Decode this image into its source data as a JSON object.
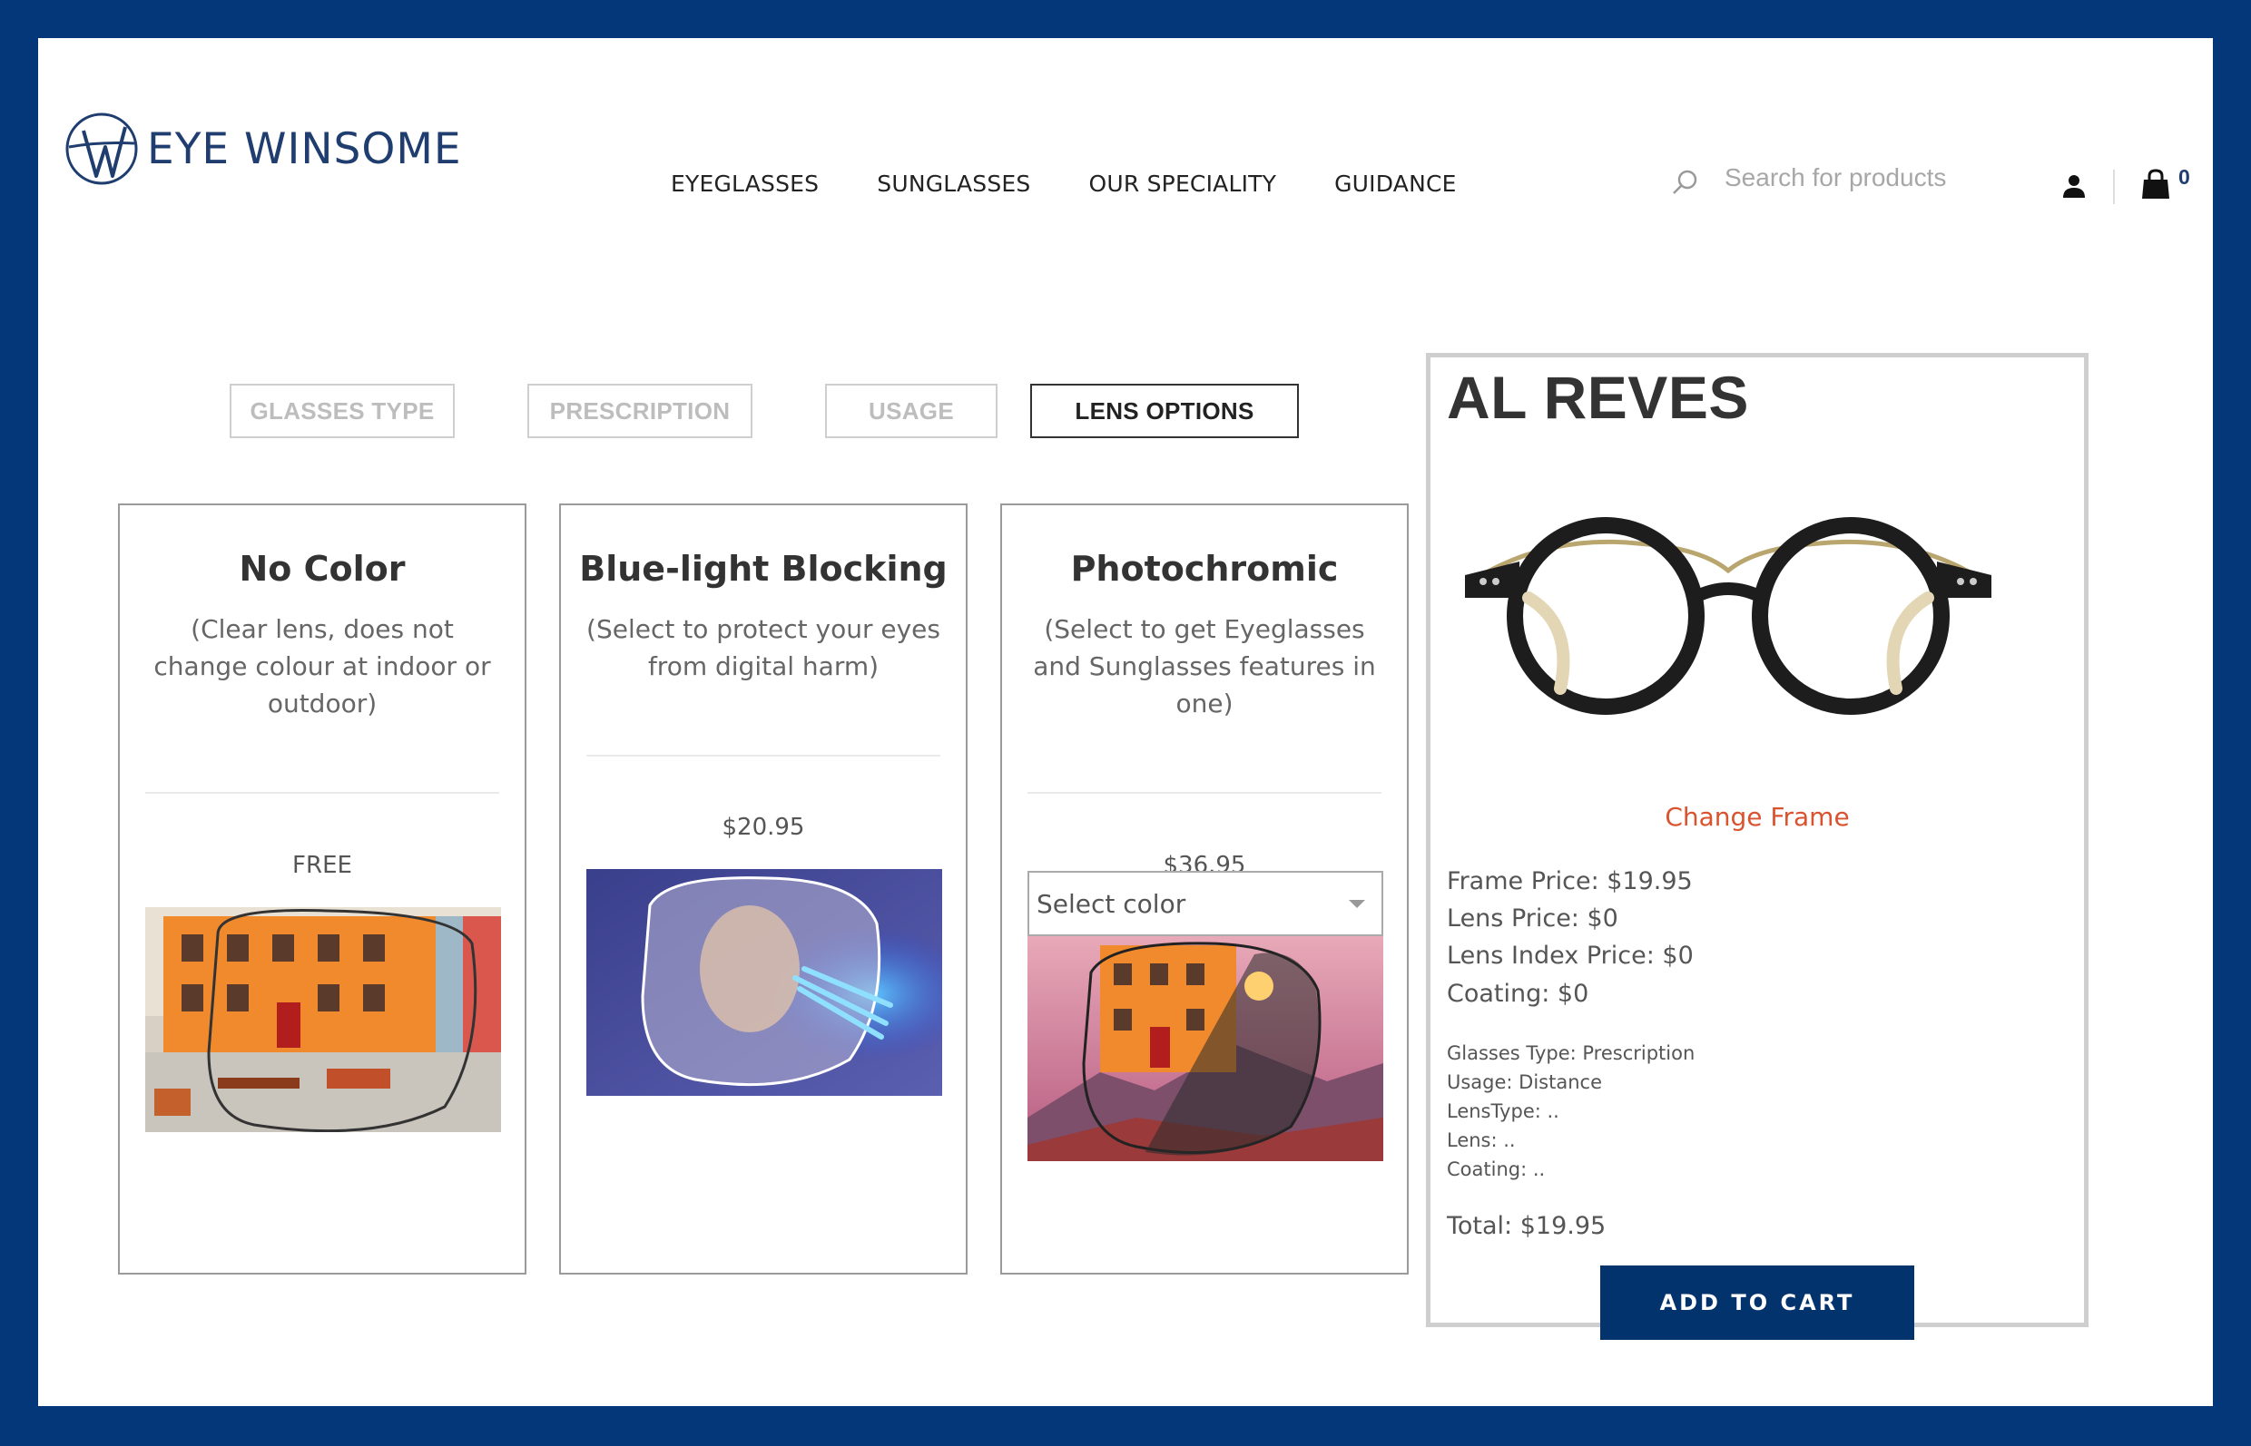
{
  "brand": {
    "name": "EYE WINSOME",
    "primary_color": "#03377a",
    "accent_color": "#d9532f"
  },
  "nav": {
    "items": [
      "EYEGLASSES",
      "SUNGLASSES",
      "OUR SPECIALITY",
      "GUIDANCE"
    ]
  },
  "search": {
    "placeholder": "Search for products",
    "icon": "search-icon"
  },
  "header_icons": {
    "user": "user-icon",
    "cart": "cart-icon",
    "cart_count": "0"
  },
  "steps": [
    {
      "label": "GLASSES TYPE",
      "active": false
    },
    {
      "label": "PRESCRIPTION",
      "active": false
    },
    {
      "label": "USAGE",
      "active": false
    },
    {
      "label": "LENS OPTIONS",
      "active": true
    }
  ],
  "lens_options": [
    {
      "title": "No Color",
      "description": "(Clear lens, does not change colour at indoor or outdoor)",
      "price": "FREE"
    },
    {
      "title": "Blue-light Blocking",
      "description": "(Select to protect your eyes from digital harm)",
      "price": "$20.95"
    },
    {
      "title": "Photochromic",
      "description": "(Select to get Eyeglasses and Sunglasses features in one)",
      "price": "$36.95",
      "select_placeholder": "Select color"
    }
  ],
  "summary": {
    "product_name": "AL REVES",
    "change_frame": "Change Frame",
    "frame_price": "Frame Price: $19.95",
    "lens_price": "Lens Price: $0",
    "lens_index_price": "Lens Index Price: $0",
    "coating_price": "Coating: $0",
    "details": [
      "Glasses Type: Prescription",
      "Usage: Distance",
      "LensType: ..",
      "Lens: ..",
      "Coating: .."
    ],
    "total": "Total: $19.95",
    "add_to_cart": "ADD TO CART"
  }
}
